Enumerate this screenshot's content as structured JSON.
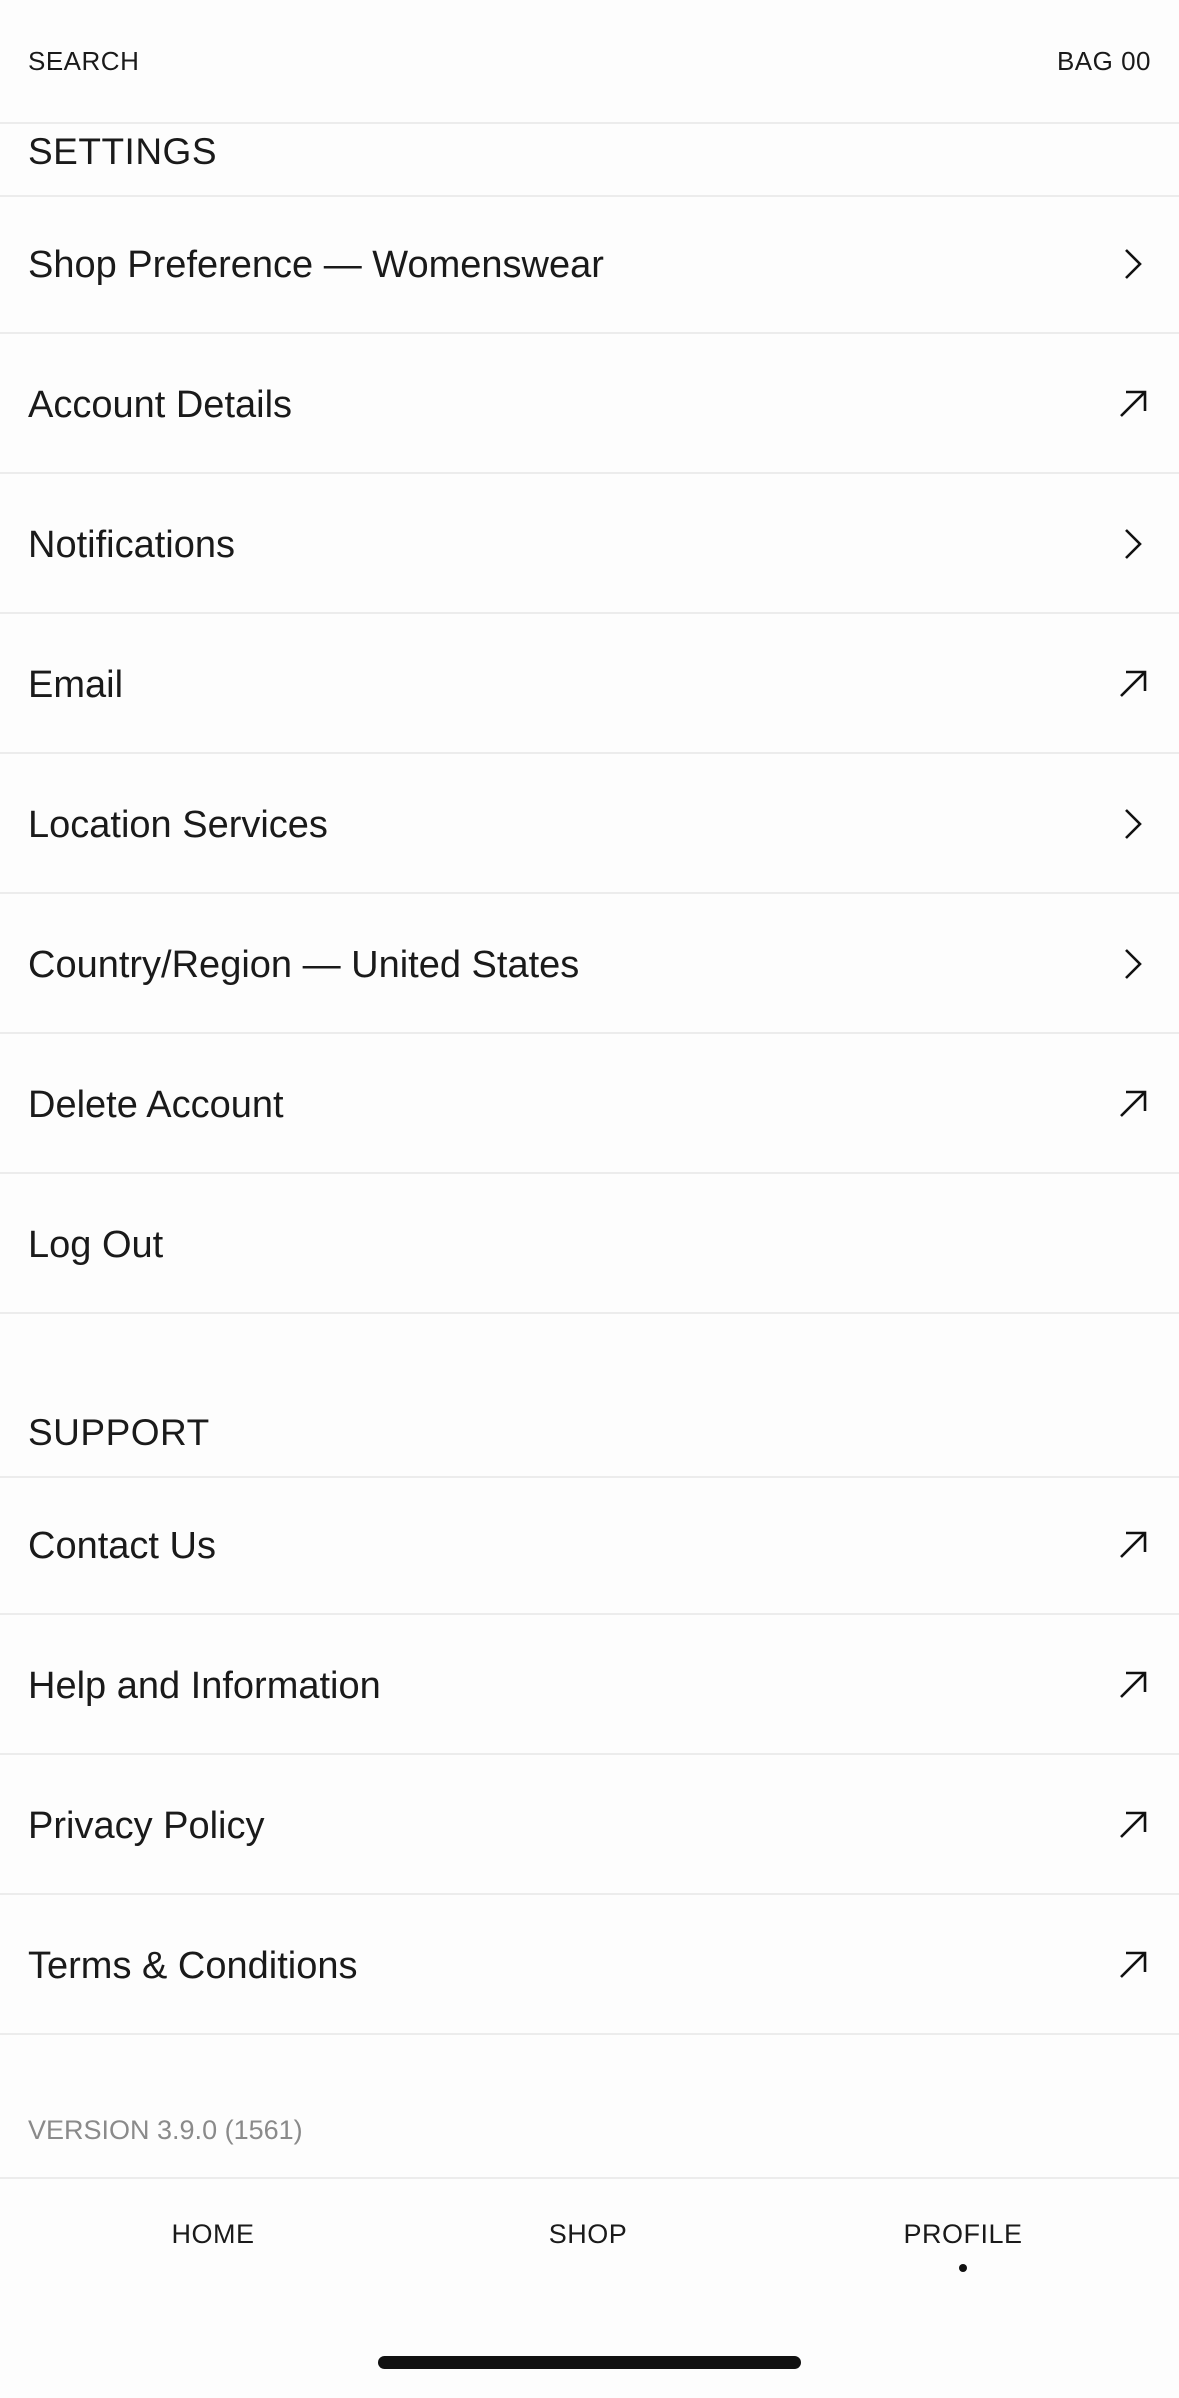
{
  "header": {
    "search_label": "SEARCH",
    "bag_label": "BAG 00"
  },
  "settings": {
    "title": "SETTINGS",
    "items": [
      {
        "label": "Shop Preference — Womenswear",
        "icon": "chevron-right-icon"
      },
      {
        "label": "Account Details",
        "icon": "arrow-up-right-icon"
      },
      {
        "label": "Notifications",
        "icon": "chevron-right-icon"
      },
      {
        "label": "Email",
        "icon": "arrow-up-right-icon"
      },
      {
        "label": "Location Services",
        "icon": "chevron-right-icon"
      },
      {
        "label": "Country/Region — United States",
        "icon": "chevron-right-icon"
      },
      {
        "label": "Delete Account",
        "icon": "arrow-up-right-icon"
      },
      {
        "label": "Log Out",
        "icon": ""
      }
    ]
  },
  "support": {
    "title": "SUPPORT",
    "items": [
      {
        "label": "Contact Us",
        "icon": "arrow-up-right-icon"
      },
      {
        "label": "Help and Information",
        "icon": "arrow-up-right-icon"
      },
      {
        "label": "Privacy Policy",
        "icon": "arrow-up-right-icon"
      },
      {
        "label": "Terms & Conditions",
        "icon": "arrow-up-right-icon"
      }
    ]
  },
  "version": "VERSION 3.9.0 (1561)",
  "tabs": [
    {
      "label": "HOME",
      "active": false
    },
    {
      "label": "SHOP",
      "active": false
    },
    {
      "label": "PROFILE",
      "active": true
    }
  ]
}
